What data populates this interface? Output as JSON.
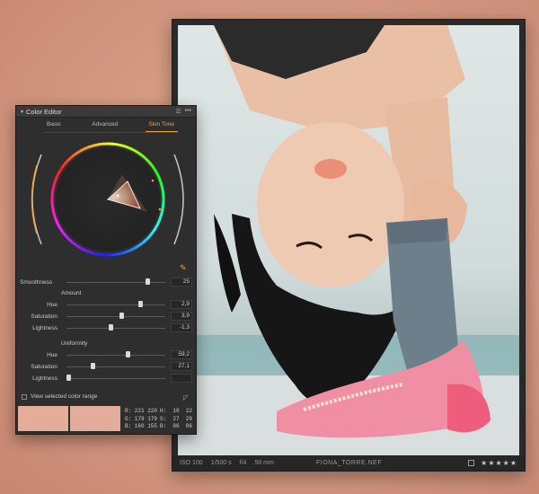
{
  "viewer": {
    "iso": "ISO 100",
    "shutter": "1/500 s",
    "aperture": "f/4",
    "focal": "50 mm",
    "filename": "FIONA_TORRE.NEF",
    "stars": "★★★★★"
  },
  "panel": {
    "collapse_glyph": "▾",
    "title": "Color Editor",
    "menu_glyph": "☰",
    "more_glyph": "•••",
    "tabs": [
      {
        "label": "Basic",
        "active": false
      },
      {
        "label": "Advanced",
        "active": false
      },
      {
        "label": "Skin Tone",
        "active": true
      }
    ],
    "smoothness": {
      "label": "Smoothness",
      "value": "25",
      "fraction": 0.82
    },
    "amount": {
      "title": "Amount",
      "hue": {
        "label": "Hue",
        "value": "2,9",
        "fraction": 0.75
      },
      "saturation": {
        "label": "Saturation",
        "value": "3,9",
        "fraction": 0.56
      },
      "lightness": {
        "label": "Lightness",
        "value": "-1,3",
        "fraction": 0.45
      }
    },
    "uniformity": {
      "title": "Uniformity",
      "hue": {
        "label": "Hue",
        "value": "59,2",
        "fraction": 0.62
      },
      "saturation": {
        "label": "Saturation",
        "value": "27,1",
        "fraction": 0.27
      },
      "lightness": {
        "label": "Lightness",
        "value": "",
        "fraction": 0.02
      }
    },
    "view_selected": "View selected color range",
    "swatch_tool_glyph": "◸",
    "swatches": [
      "#e5ac99",
      "#e3ac9b"
    ],
    "readout_left": "R: 221 220\nG: 179 179\nB: 160 155",
    "readout_right": "H:  18  22\nS:  27  29\nB:  86  86"
  },
  "colors": {
    "accent": "#f0a23a",
    "panel_bg": "#2e2e2e"
  }
}
